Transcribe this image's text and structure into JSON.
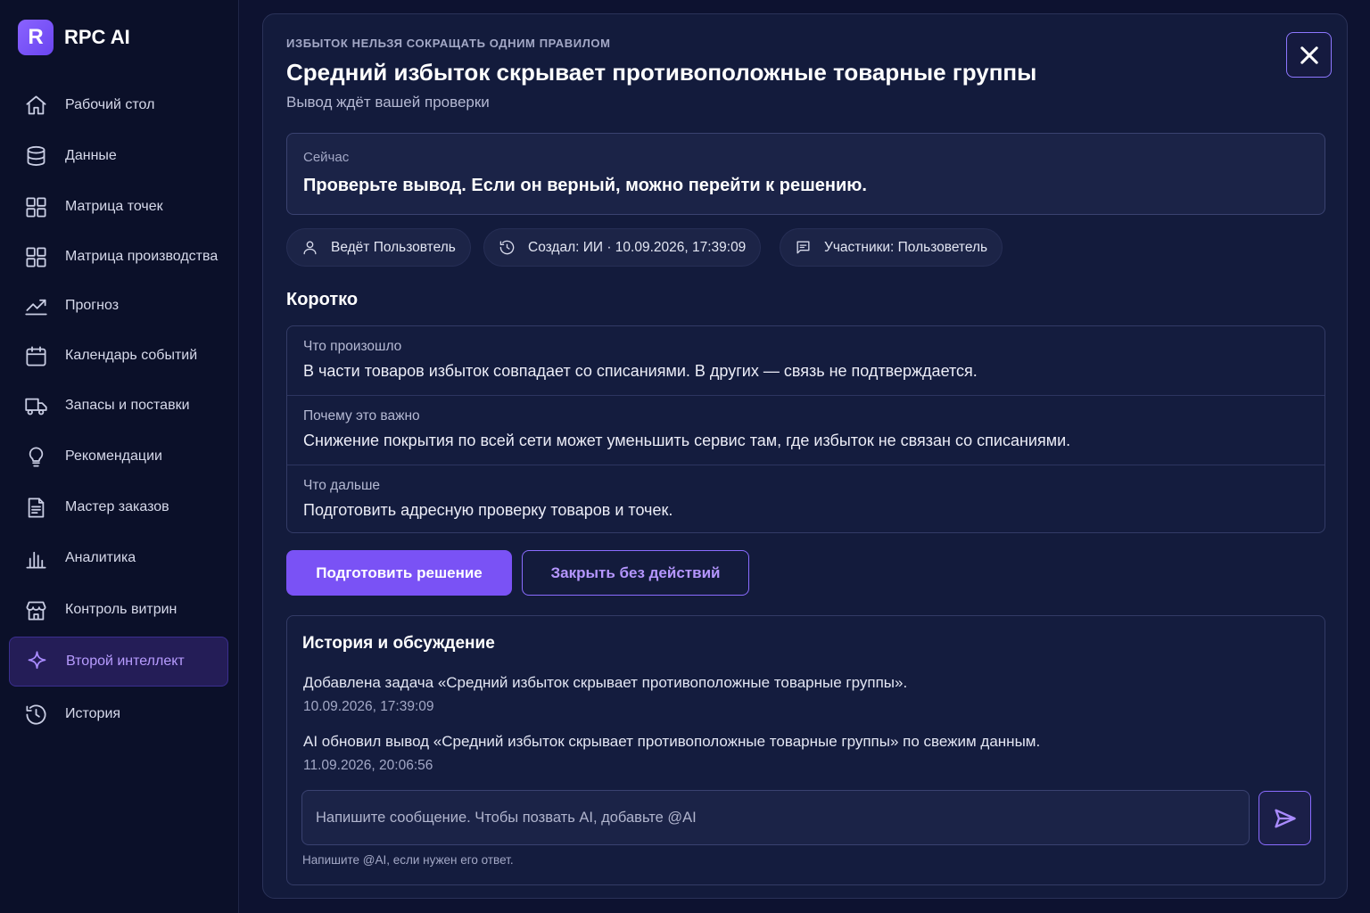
{
  "app": {
    "logo_letter": "R",
    "name": "RPC AI",
    "accent_color": "#7a52f5"
  },
  "sidebar": {
    "items": [
      {
        "label": "Рабочий стол",
        "icon": "home-icon"
      },
      {
        "label": "Данные",
        "icon": "database-icon"
      },
      {
        "label": "Матрица точек",
        "icon": "grid-icon"
      },
      {
        "label": "Матрица производства",
        "icon": "grid-icon"
      },
      {
        "label": "Прогноз",
        "icon": "trend-chart-icon"
      },
      {
        "label": "Календарь событий",
        "icon": "calendar-icon"
      },
      {
        "label": "Запасы и поставки",
        "icon": "truck-icon"
      },
      {
        "label": "Рекомендации",
        "icon": "lightbulb-icon"
      },
      {
        "label": "Мастер заказов",
        "icon": "document-icon"
      },
      {
        "label": "Аналитика",
        "icon": "bar-chart-icon"
      },
      {
        "label": "Контроль витрин",
        "icon": "storefront-icon"
      },
      {
        "label": "Второй интеллект",
        "icon": "sparkle-icon",
        "active": true
      },
      {
        "label": "История",
        "icon": "history-icon"
      }
    ]
  },
  "panel": {
    "eyebrow": "Избыток нельзя сокращать одним правилом",
    "title": "Средний избыток скрывает противоположные товарные группы",
    "subtitle": "Вывод ждёт вашей проверки",
    "now": {
      "label": "Сейчас",
      "text": "Проверьте вывод. Если он верный, можно перейти к решению."
    },
    "chips": {
      "owner": "Ведёт Пользовтель",
      "created": "Создал: ИИ · 10.09.2026, 17:39:09",
      "participants": "Участники: Пользоветель"
    },
    "summary": {
      "title": "Коротко",
      "rows": [
        {
          "label": "Что произошло",
          "value": "В части товаров избыток совпадает со списаниями. В других — связь не подтверждается."
        },
        {
          "label": "Почему это важно",
          "value": "Снижение покрытия по всей сети может уменьшить сервис там, где избыток не связан со списаниями."
        },
        {
          "label": "Что дальше",
          "value": "Подготовить адресную проверку товаров и точек."
        }
      ]
    },
    "actions": {
      "primary": "Подготовить решение",
      "secondary": "Закрыть без действий"
    },
    "history": {
      "title": "История и обсуждение",
      "entries": [
        {
          "text": "Добавлена задача «Средний избыток скрывает противоположные товарные группы».",
          "date": "10.09.2026, 17:39:09"
        },
        {
          "text": "AI обновил вывод «Средний избыток скрывает противоположные товарные группы» по свежим данным.",
          "date": "11.09.2026, 20:06:56"
        }
      ],
      "input_placeholder": "Напишите сообщение. Чтобы позвать AI, добавьте @AI",
      "input_value": "",
      "hint": "Напишите @AI, если нужен его ответ."
    }
  }
}
